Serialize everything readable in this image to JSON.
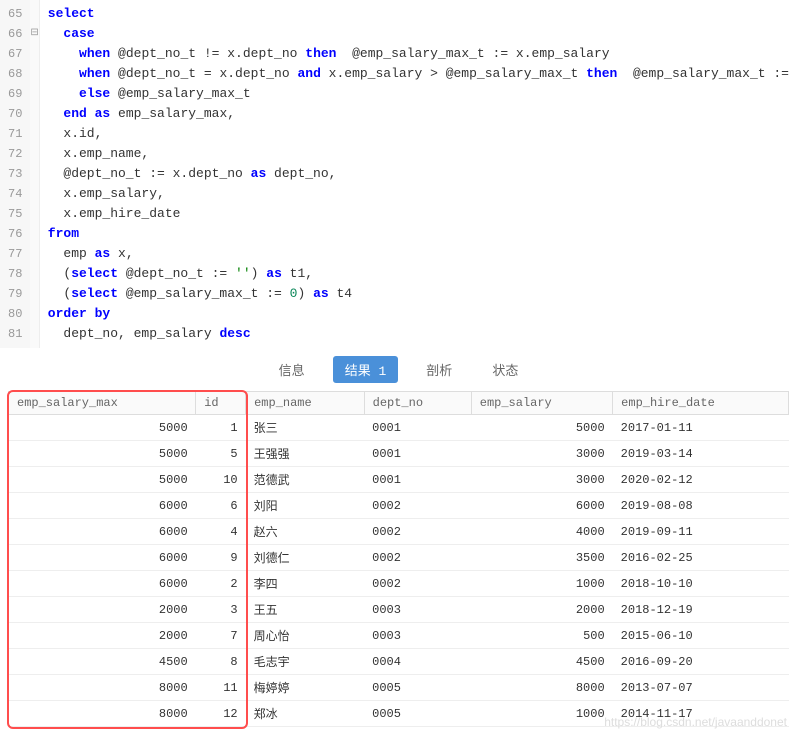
{
  "code": {
    "lines": [
      {
        "n": 65,
        "fold": "",
        "tokens": [
          [
            "kw",
            "select"
          ]
        ]
      },
      {
        "n": 66,
        "fold": "⊟",
        "tokens": [
          [
            "ident",
            "  "
          ],
          [
            "kw",
            "case"
          ]
        ]
      },
      {
        "n": 67,
        "fold": "",
        "tokens": [
          [
            "ident",
            "    "
          ],
          [
            "kw",
            "when"
          ],
          [
            "ident",
            " @dept_no_t != x.dept_no "
          ],
          [
            "kw",
            "then"
          ],
          [
            "ident",
            "  @emp_salary_max_t := x.emp_salary"
          ]
        ]
      },
      {
        "n": 68,
        "fold": "",
        "tokens": [
          [
            "ident",
            "    "
          ],
          [
            "kw",
            "when"
          ],
          [
            "ident",
            " @dept_no_t = x.dept_no "
          ],
          [
            "kw",
            "and"
          ],
          [
            "ident",
            " x.emp_salary > @emp_salary_max_t "
          ],
          [
            "kw",
            "then"
          ],
          [
            "ident",
            "  @emp_salary_max_t := x.emp_salary"
          ]
        ]
      },
      {
        "n": 69,
        "fold": "",
        "tokens": [
          [
            "ident",
            "    "
          ],
          [
            "kw",
            "else"
          ],
          [
            "ident",
            " @emp_salary_max_t"
          ]
        ]
      },
      {
        "n": 70,
        "fold": "",
        "tokens": [
          [
            "ident",
            "  "
          ],
          [
            "kw",
            "end"
          ],
          [
            "ident",
            " "
          ],
          [
            "kw",
            "as"
          ],
          [
            "ident",
            " emp_salary_max,"
          ]
        ]
      },
      {
        "n": 71,
        "fold": "",
        "tokens": [
          [
            "ident",
            "  x.id,"
          ]
        ]
      },
      {
        "n": 72,
        "fold": "",
        "tokens": [
          [
            "ident",
            "  x.emp_name,"
          ]
        ]
      },
      {
        "n": 73,
        "fold": "",
        "tokens": [
          [
            "ident",
            "  @dept_no_t := x.dept_no "
          ],
          [
            "kw",
            "as"
          ],
          [
            "ident",
            " dept_no,"
          ]
        ]
      },
      {
        "n": 74,
        "fold": "",
        "tokens": [
          [
            "ident",
            "  x.emp_salary,"
          ]
        ]
      },
      {
        "n": 75,
        "fold": "",
        "tokens": [
          [
            "ident",
            "  x.emp_hire_date"
          ]
        ]
      },
      {
        "n": 76,
        "fold": "",
        "tokens": [
          [
            "kw",
            "from"
          ]
        ]
      },
      {
        "n": 77,
        "fold": "",
        "tokens": [
          [
            "ident",
            "  emp "
          ],
          [
            "kw",
            "as"
          ],
          [
            "ident",
            " x,"
          ]
        ]
      },
      {
        "n": 78,
        "fold": "",
        "tokens": [
          [
            "ident",
            "  ("
          ],
          [
            "kw",
            "select"
          ],
          [
            "ident",
            " @dept_no_t := "
          ],
          [
            "str",
            "''"
          ],
          [
            "ident",
            ") "
          ],
          [
            "kw",
            "as"
          ],
          [
            "ident",
            " t1,"
          ]
        ]
      },
      {
        "n": 79,
        "fold": "",
        "tokens": [
          [
            "ident",
            "  ("
          ],
          [
            "kw",
            "select"
          ],
          [
            "ident",
            " @emp_salary_max_t := "
          ],
          [
            "num",
            "0"
          ],
          [
            "ident",
            ") "
          ],
          [
            "kw",
            "as"
          ],
          [
            "ident",
            " t4"
          ]
        ]
      },
      {
        "n": 80,
        "fold": "",
        "tokens": [
          [
            "kw",
            "order by"
          ]
        ]
      },
      {
        "n": 81,
        "fold": "",
        "tokens": [
          [
            "ident",
            "  dept_no, emp_salary "
          ],
          [
            "kw",
            "desc"
          ]
        ]
      }
    ]
  },
  "tabs": {
    "items": [
      {
        "label": "信息",
        "active": false
      },
      {
        "label": "结果 1",
        "active": true
      },
      {
        "label": "剖析",
        "active": false
      },
      {
        "label": "状态",
        "active": false
      }
    ]
  },
  "results": {
    "columns": [
      "emp_salary_max",
      "id",
      "emp_name",
      "dept_no",
      "emp_salary",
      "emp_hire_date"
    ],
    "rows": [
      {
        "emp_salary_max": "5000",
        "id": "1",
        "emp_name": "张三",
        "dept_no": "0001",
        "emp_salary": "5000",
        "emp_hire_date": "2017-01-11"
      },
      {
        "emp_salary_max": "5000",
        "id": "5",
        "emp_name": "王强强",
        "dept_no": "0001",
        "emp_salary": "3000",
        "emp_hire_date": "2019-03-14"
      },
      {
        "emp_salary_max": "5000",
        "id": "10",
        "emp_name": "范德武",
        "dept_no": "0001",
        "emp_salary": "3000",
        "emp_hire_date": "2020-02-12"
      },
      {
        "emp_salary_max": "6000",
        "id": "6",
        "emp_name": "刘阳",
        "dept_no": "0002",
        "emp_salary": "6000",
        "emp_hire_date": "2019-08-08"
      },
      {
        "emp_salary_max": "6000",
        "id": "4",
        "emp_name": "赵六",
        "dept_no": "0002",
        "emp_salary": "4000",
        "emp_hire_date": "2019-09-11"
      },
      {
        "emp_salary_max": "6000",
        "id": "9",
        "emp_name": "刘德仁",
        "dept_no": "0002",
        "emp_salary": "3500",
        "emp_hire_date": "2016-02-25"
      },
      {
        "emp_salary_max": "6000",
        "id": "2",
        "emp_name": "李四",
        "dept_no": "0002",
        "emp_salary": "1000",
        "emp_hire_date": "2018-10-10"
      },
      {
        "emp_salary_max": "2000",
        "id": "3",
        "emp_name": "王五",
        "dept_no": "0003",
        "emp_salary": "2000",
        "emp_hire_date": "2018-12-19"
      },
      {
        "emp_salary_max": "2000",
        "id": "7",
        "emp_name": "周心怡",
        "dept_no": "0003",
        "emp_salary": "500",
        "emp_hire_date": "2015-06-10"
      },
      {
        "emp_salary_max": "4500",
        "id": "8",
        "emp_name": "毛志宇",
        "dept_no": "0004",
        "emp_salary": "4500",
        "emp_hire_date": "2016-09-20"
      },
      {
        "emp_salary_max": "8000",
        "id": "11",
        "emp_name": "梅婷婷",
        "dept_no": "0005",
        "emp_salary": "8000",
        "emp_hire_date": "2013-07-07"
      },
      {
        "emp_salary_max": "8000",
        "id": "12",
        "emp_name": "郑冰",
        "dept_no": "0005",
        "emp_salary": "1000",
        "emp_hire_date": "2014-11-17"
      }
    ]
  },
  "watermark": "https://blog.csdn.net/javaanddonet"
}
